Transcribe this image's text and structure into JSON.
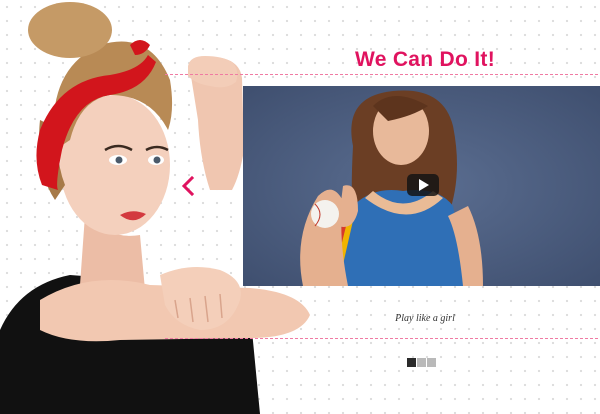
{
  "slide": {
    "headline": "We Can Do It!",
    "caption": "Play like a girl"
  },
  "colors": {
    "accent": "#e0135f",
    "rule": "#f07aa3",
    "pager_active": "#2a2a2a",
    "pager_inactive": "#b9b9b9"
  },
  "controls": {
    "prev_icon": "chevron-left-icon",
    "play_icon": "play-icon"
  },
  "pager": {
    "count": 3,
    "active_index": 0
  }
}
